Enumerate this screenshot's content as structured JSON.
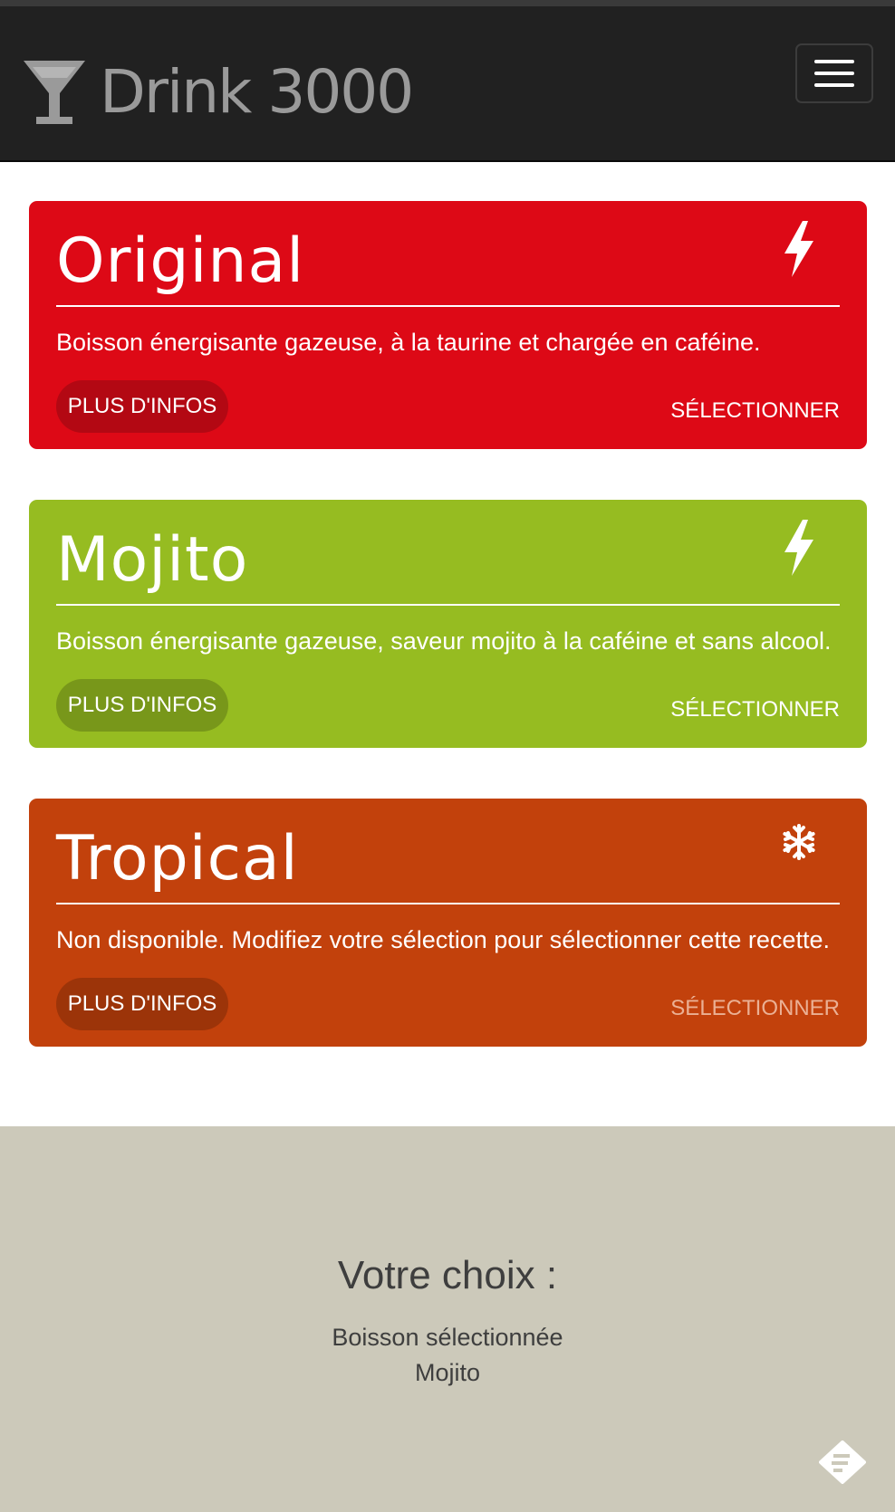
{
  "app": {
    "title": "Drink 3000"
  },
  "colors": {
    "navbar": "#212121",
    "original": "#dd0916",
    "original_button": "#b30813",
    "mojito": "#96bc21",
    "mojito_button": "#78971a",
    "tropical": "#c2410c",
    "tropical_button": "#9c3409",
    "footer": "#ccc9ba"
  },
  "drinks": [
    {
      "name": "Original",
      "icon": "lightning-icon",
      "description": "Boisson énergisante gazeuse, à la taurine et chargée en caféine.",
      "info_label": "PLUS D'INFOS",
      "select_label": "SÉLECTIONNER",
      "available": true
    },
    {
      "name": "Mojito",
      "icon": "lightning-icon",
      "description": "Boisson énergisante gazeuse, saveur mojito à la caféine et sans alcool.",
      "info_label": "PLUS D'INFOS",
      "select_label": "SÉLECTIONNER",
      "available": true
    },
    {
      "name": "Tropical",
      "icon": "snowflake-icon",
      "description": "Non disponible. Modifiez votre sélection pour sélectionner cette recette.",
      "info_label": "PLUS D'INFOS",
      "select_label": "SÉLECTIONNER",
      "available": false
    }
  ],
  "summary": {
    "heading": "Votre choix :",
    "label": "Boisson sélectionnée",
    "value": "Mojito"
  }
}
